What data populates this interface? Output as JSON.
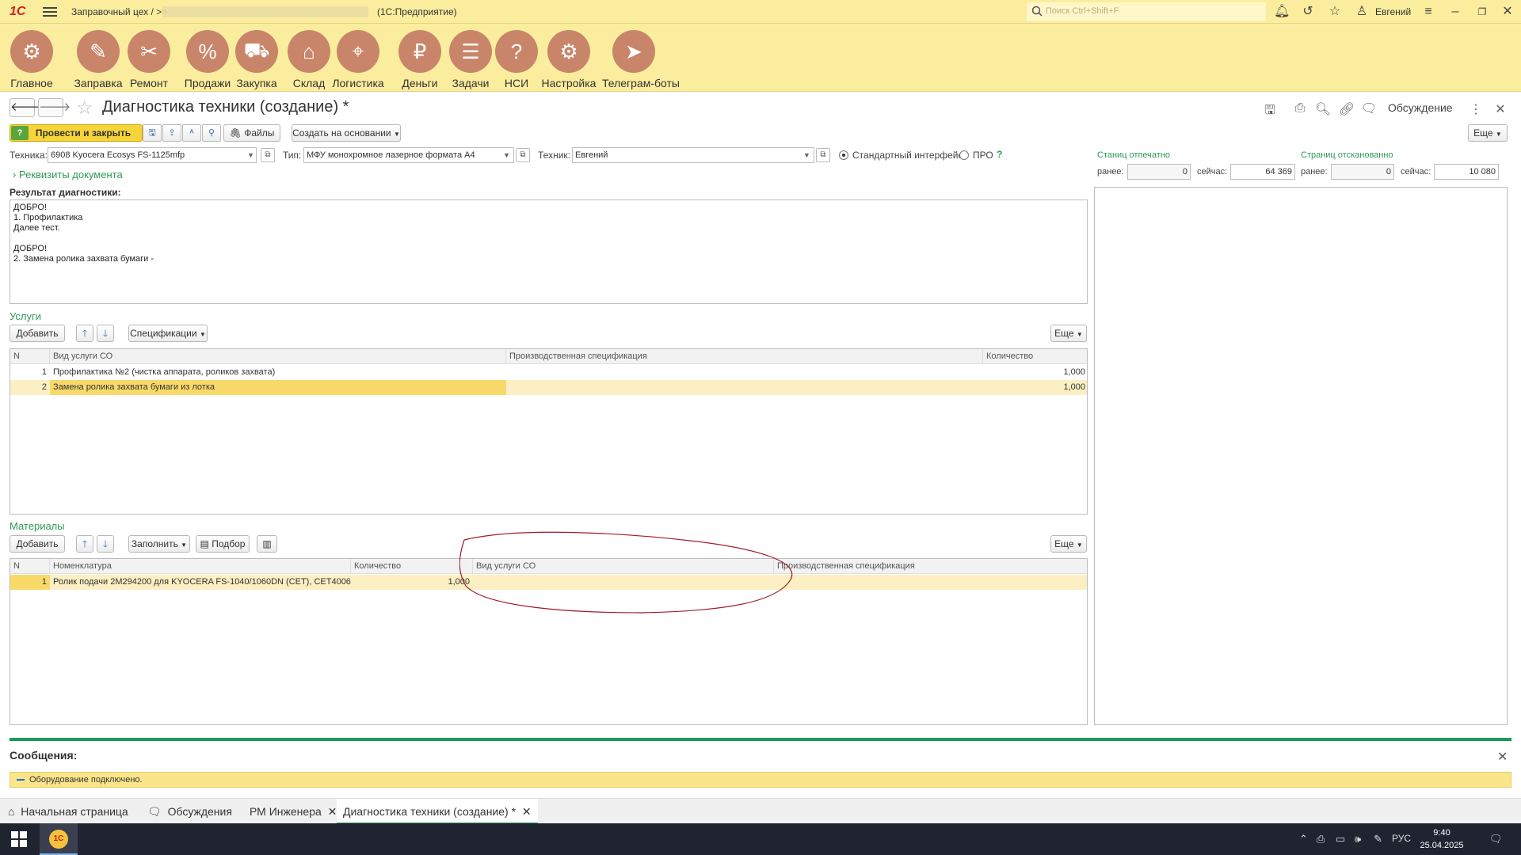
{
  "titlebar": {
    "breadcrumb": "Заправочный цех / >>",
    "platform": "(1С:Предприятие)",
    "search_placeholder": "Поиск Ctrl+Shift+F",
    "user": "Евгений"
  },
  "sections": [
    {
      "label": "Главное",
      "icon": "gears-icon"
    },
    {
      "label": "Заправка",
      "icon": "printer-cartridge-icon"
    },
    {
      "label": "Ремонт",
      "icon": "tools-icon"
    },
    {
      "label": "Продажи",
      "icon": "sale-icon"
    },
    {
      "label": "Закупка",
      "icon": "cart-icon"
    },
    {
      "label": "Склад",
      "icon": "warehouse-icon"
    },
    {
      "label": "Логистика",
      "icon": "map-icon"
    },
    {
      "label": "Деньги",
      "icon": "money-bag-icon"
    },
    {
      "label": "Задачи",
      "icon": "tasks-icon"
    },
    {
      "label": "НСИ",
      "icon": "book-icon"
    },
    {
      "label": "Настройка",
      "icon": "settings-icon"
    },
    {
      "label": "Телеграм-боты",
      "icon": "telegram-icon"
    }
  ],
  "form": {
    "title": "Диагностика техники (создание) *",
    "discuss": "Обсуждение",
    "post_close": "Провести и закрыть",
    "files": "Файлы",
    "create_based": "Создать на основании",
    "more": "Еще",
    "technique_label": "Техника:",
    "technique_value": "6908 Kyocera Ecosys FS-1125mfp",
    "type_label": "Тип:",
    "type_value": "МФУ  монохромное лазерное формата А4",
    "tech_label": "Техник:",
    "tech_value": "Евгений",
    "radio_standard": "Стандартный интерфейс",
    "radio_pro": "ПРО",
    "help": "?",
    "requisites": "Реквизиты документа",
    "result_label": "Результат диагностики:",
    "result_text": "ДОБРО!\n1. Профилактика\nДалее тест.\n\nДОБРО!\n2. Замена ролика захвата бумаги - "
  },
  "counters": {
    "printed_title": "Станиц отпечатно",
    "scanned_title": "Страниц отсканованно",
    "before_label": "ранее:",
    "now_label": "сейчас:",
    "printed_before": "0",
    "printed_now": "64 369",
    "scanned_before": "0",
    "scanned_now": "10 080"
  },
  "services": {
    "title": "Услуги",
    "add": "Добавить",
    "specs": "Спецификации",
    "more": "Еще",
    "columns": [
      "N",
      "Вид услуги СО",
      "Производственная спецификация",
      "Количество"
    ],
    "rows": [
      {
        "n": "1",
        "service": "Профилактика №2 (чистка аппарата, роликов захвата)",
        "spec": "",
        "qty": "1,000"
      },
      {
        "n": "2",
        "service": "Замена ролика захвата бумаги из лотка",
        "spec": "",
        "qty": "1,000"
      }
    ]
  },
  "materials": {
    "title": "Материалы",
    "add": "Добавить",
    "fill": "Заполнить",
    "pick": "Подбор",
    "more": "Еще",
    "columns": [
      "N",
      "Номенклатура",
      "Количество",
      "Вид услуги СО",
      "Производственная спецификация"
    ],
    "rows": [
      {
        "n": "1",
        "item": "Ролик подачи 2M294200 для KYOCERA FS-1040/1060DN (CET), CET4006",
        "qty": "1,000",
        "service": "",
        "spec": ""
      }
    ]
  },
  "messages": {
    "title": "Сообщения:",
    "text": "Оборудование подключено."
  },
  "window_tabs": [
    {
      "label": "Начальная страница",
      "icon": "home-icon"
    },
    {
      "label": "Обсуждения",
      "icon": "chat-icon"
    },
    {
      "label": "РМ Инженера"
    },
    {
      "label": "Диагностика техники (создание) *"
    }
  ],
  "taskbar": {
    "lang": "РУС",
    "time": "9:40",
    "date": "25.04.2025"
  },
  "colors": {
    "header_bg": "#fbed9e",
    "accent_green": "#2e9a58",
    "section_icon": "#c9856a",
    "post_button": "#f7d53a"
  }
}
